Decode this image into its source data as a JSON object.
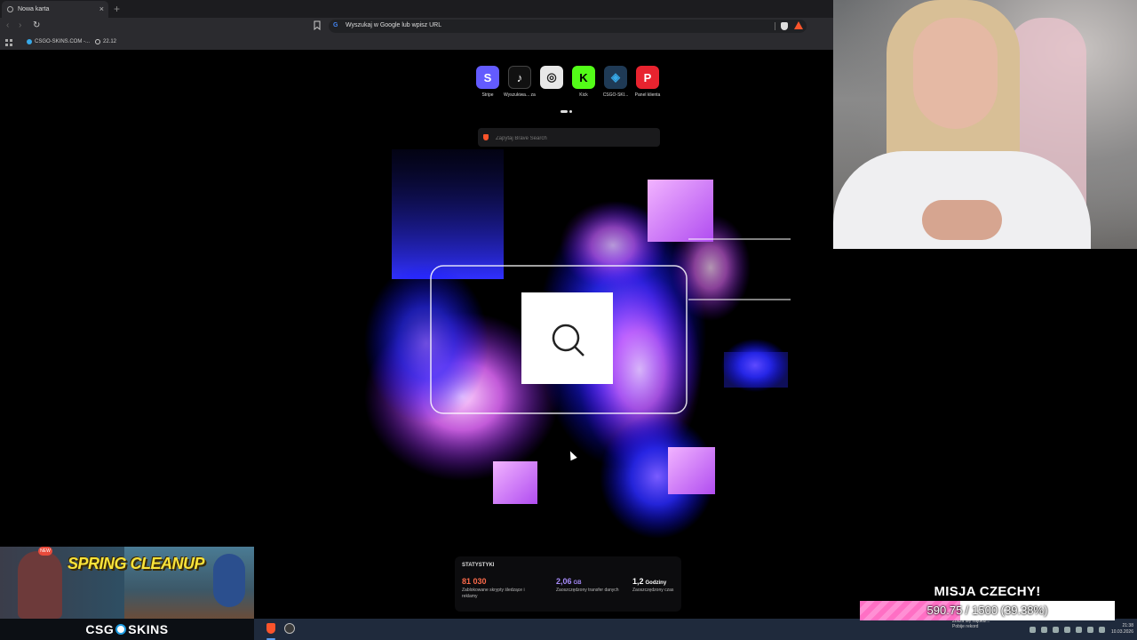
{
  "browser": {
    "tab_title": "Nowa karta",
    "tab_close": "×",
    "new_tab": "+",
    "address_placeholder": "Wyszukaj w Google lub wpisz URL",
    "bookmarks": [
      {
        "label": "CSGO-SKINS.COM -...",
        "icon": "csgo-skins-icon"
      },
      {
        "label": "22.12",
        "icon": "globe-icon"
      }
    ]
  },
  "new_tab_page": {
    "top_sites": [
      {
        "label": "Stripe",
        "color": "#635bff",
        "glyph": "S"
      },
      {
        "label": "Wyszukiwa... zadanka - I...",
        "color": "#111111",
        "glyph": "♪"
      },
      {
        "label": "",
        "color": "#e8e8e8",
        "glyph": "◎"
      },
      {
        "label": "Kick",
        "color": "#53fc18",
        "glyph": "K"
      },
      {
        "label": "CSGO-SKI...",
        "color": "#2a9fd8",
        "glyph": "◈"
      },
      {
        "label": "Panel klienta",
        "color": "#e8232f",
        "glyph": "P"
      }
    ],
    "search_placeholder": "Zapytaj Brave Search",
    "stats": {
      "title": "STATYSTYKI",
      "items": [
        {
          "value": "81 030",
          "unit": "",
          "desc": "Zablokowane skrypty śledzące i reklamy",
          "color": "#fb6a4a"
        },
        {
          "value": "2,06",
          "unit": "GB",
          "desc": "Zaoszczędzony transfer danych",
          "color": "#a78bfa"
        },
        {
          "value": "1,2",
          "unit": "Godziny",
          "desc": "Zaoszczędzony czas",
          "color": "#ffffff"
        }
      ]
    }
  },
  "game_ad": {
    "headline": "SPRING CLEANUP",
    "badge": "NEW"
  },
  "taskbar": {
    "brand_left": "CSG",
    "brand_right": "SKINS",
    "record_line1": "Zbliża się najdłuż...",
    "record_line2": "Pobije rekord",
    "time": "21:38",
    "date": "10.03.2026"
  },
  "mission": {
    "title": "MISJA CZECHY!",
    "progress_text": "590.75 / 1500 (39.38%)",
    "progress_fraction": 0.3938
  }
}
